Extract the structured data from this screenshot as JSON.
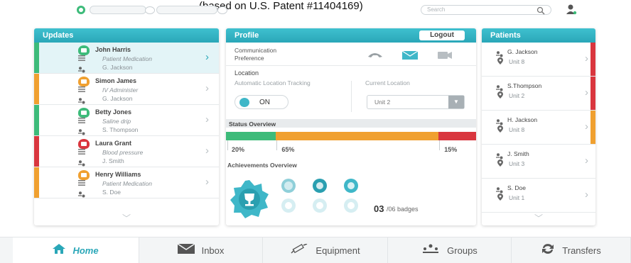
{
  "caption": "(based on U.S. Patent #11404169)",
  "search": {
    "placeholder": "Search"
  },
  "colors": {
    "teal": "#2aa7b8",
    "green": "#3dbb7a",
    "red": "#d9363e",
    "orange": "#f0a030"
  },
  "updates": {
    "title": "Updates",
    "items": [
      {
        "name": "John Harris",
        "detail": "Patient Medication",
        "staff": "G. Jackson",
        "status": "green",
        "selected": true
      },
      {
        "name": "Simon James",
        "detail": "IV Administer",
        "staff": "G. Jackson",
        "status": "orange",
        "selected": false
      },
      {
        "name": "Betty Jones",
        "detail": "Saline drip",
        "staff": "S. Thompson",
        "status": "green",
        "selected": false
      },
      {
        "name": "Laura Grant",
        "detail": "Blood pressure",
        "staff": "J. Smith",
        "status": "red",
        "selected": false
      },
      {
        "name": "Henry Williams",
        "detail": "Patient Medication",
        "staff": "S. Doe",
        "status": "orange",
        "selected": false
      }
    ]
  },
  "profile": {
    "title": "Profile",
    "logout_label": "Logout",
    "communication_label": "Communication\nPreference",
    "location": {
      "title": "Location",
      "tracking_label": "Automatic Location Tracking",
      "toggle_state": "ON",
      "current_label": "Current Location",
      "current_value": "Unit 2"
    },
    "status_overview": {
      "title": "Status Overview",
      "segments": [
        {
          "label": "20%",
          "value": 20,
          "color": "#3dbb7a"
        },
        {
          "label": "65%",
          "value": 65,
          "color": "#f0a030"
        },
        {
          "label": "15%",
          "value": 15,
          "color": "#d9363e"
        }
      ]
    },
    "achievements": {
      "title": "Achievements Overview",
      "badge_count": "03",
      "badge_total": "/06 badges"
    }
  },
  "patients": {
    "title": "Patients",
    "items": [
      {
        "name": "G. Jackson",
        "unit": "Unit 8",
        "status": "red"
      },
      {
        "name": "S.Thompson",
        "unit": "Unit 2",
        "status": "red"
      },
      {
        "name": "H. Jackson",
        "unit": "Unit 8",
        "status": "orange"
      },
      {
        "name": "J. Smith",
        "unit": "Unit 3",
        "status": ""
      },
      {
        "name": "S. Doe",
        "unit": "Unit 1",
        "status": ""
      }
    ]
  },
  "nav": [
    {
      "label": "Home",
      "icon": "home-icon",
      "active": true
    },
    {
      "label": "Inbox",
      "icon": "envelope-icon",
      "active": false
    },
    {
      "label": "Equipment",
      "icon": "syringe-icon",
      "active": false
    },
    {
      "label": "Groups",
      "icon": "groups-icon",
      "active": false
    },
    {
      "label": "Transfers",
      "icon": "transfer-icon",
      "active": false
    }
  ]
}
